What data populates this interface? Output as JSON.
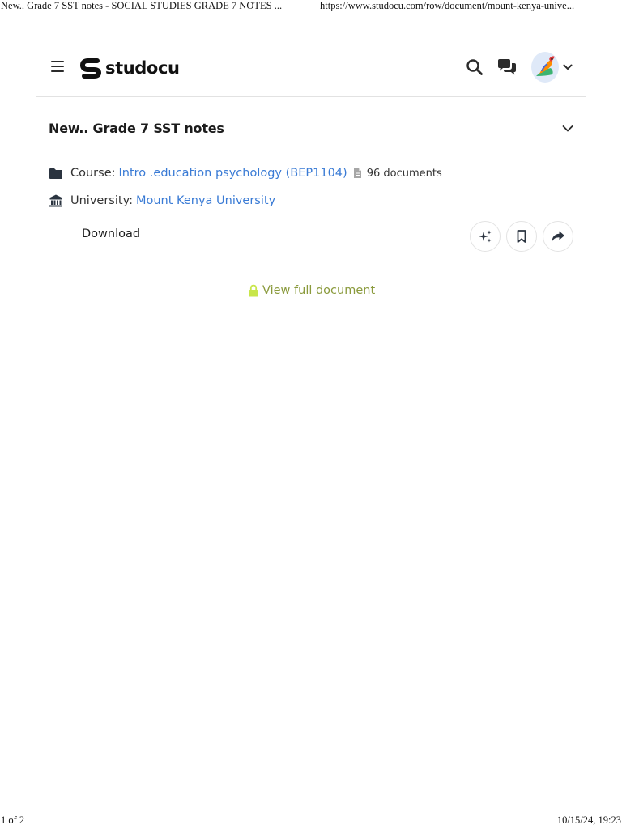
{
  "print_header": {
    "title": "New.. Grade 7 SST notes - SOCIAL STUDIES GRADE 7 NOTES ...",
    "url": "https://www.studocu.com/row/document/mount-kenya-unive..."
  },
  "navbar": {
    "logo_text": "studocu",
    "icons": {
      "menu": "hamburger-icon",
      "search": "search-icon",
      "chat": "chat-icon",
      "avatar": "avatar",
      "dropdown": "chevron-down-icon"
    }
  },
  "document": {
    "title": "New.. Grade 7 SST notes",
    "course_label": "Course:",
    "course_name": "Intro .education psychology (BEP1104)",
    "documents_count": "96 documents",
    "university_label": "University:",
    "university_name": "Mount Kenya University",
    "download_label": "Download",
    "actions": [
      "sparkle-icon",
      "bookmark-icon",
      "share-icon"
    ],
    "view_full_label": "View full document"
  },
  "print_footer": {
    "page": "1 of 2",
    "datetime": "10/15/24, 19:23"
  },
  "colors": {
    "link": "#3a7bd5",
    "view_full": "#8a9a3c",
    "lock": "#c8e64a",
    "avatar_bg": "#dfe9f8"
  }
}
